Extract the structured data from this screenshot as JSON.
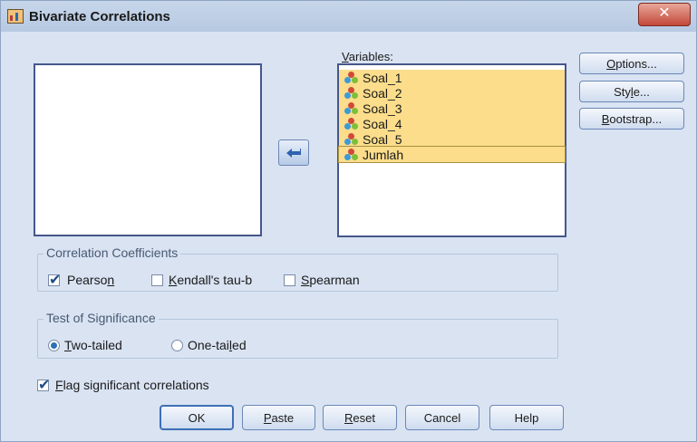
{
  "window": {
    "title": "Bivariate Correlations",
    "close_glyph": "✕"
  },
  "variables": {
    "label_ul": "V",
    "label_rest": "ariables:",
    "items": [
      {
        "label": "Soal_1"
      },
      {
        "label": "Soal_2"
      },
      {
        "label": "Soal_3"
      },
      {
        "label": "Soal_4"
      },
      {
        "label": "Soal_5"
      },
      {
        "label": "Jumlah"
      }
    ]
  },
  "side_buttons": {
    "options_ul": "O",
    "options_rest": "ptions...",
    "style_pre": "Sty",
    "style_ul": "l",
    "style_post": "e...",
    "bootstrap_ul": "B",
    "bootstrap_rest": "ootstrap..."
  },
  "coefficients": {
    "title": "Correlation Coefficients",
    "pearson_pre": "Pearso",
    "pearson_ul": "n",
    "pearson_checked": true,
    "kendall_ul": "K",
    "kendall_rest": "endall's tau-b",
    "kendall_checked": false,
    "spearman_ul": "S",
    "spearman_rest": "pearman",
    "spearman_checked": false
  },
  "significance": {
    "title": "Test of Significance",
    "two_ul": "T",
    "two_rest": "wo-tailed",
    "two_selected": true,
    "one_pre": "One-tai",
    "one_ul": "l",
    "one_post": "ed",
    "one_selected": false
  },
  "flag": {
    "ul": "F",
    "rest": "lag significant correlations",
    "checked": true
  },
  "bottom_buttons": {
    "ok": "OK",
    "paste_ul": "P",
    "paste_rest": "aste",
    "reset_ul": "R",
    "reset_rest": "eset",
    "cancel": "Cancel",
    "help": "Help"
  },
  "colors": {
    "selection": "#fbdd8b",
    "accent": "#3d6fb5"
  }
}
